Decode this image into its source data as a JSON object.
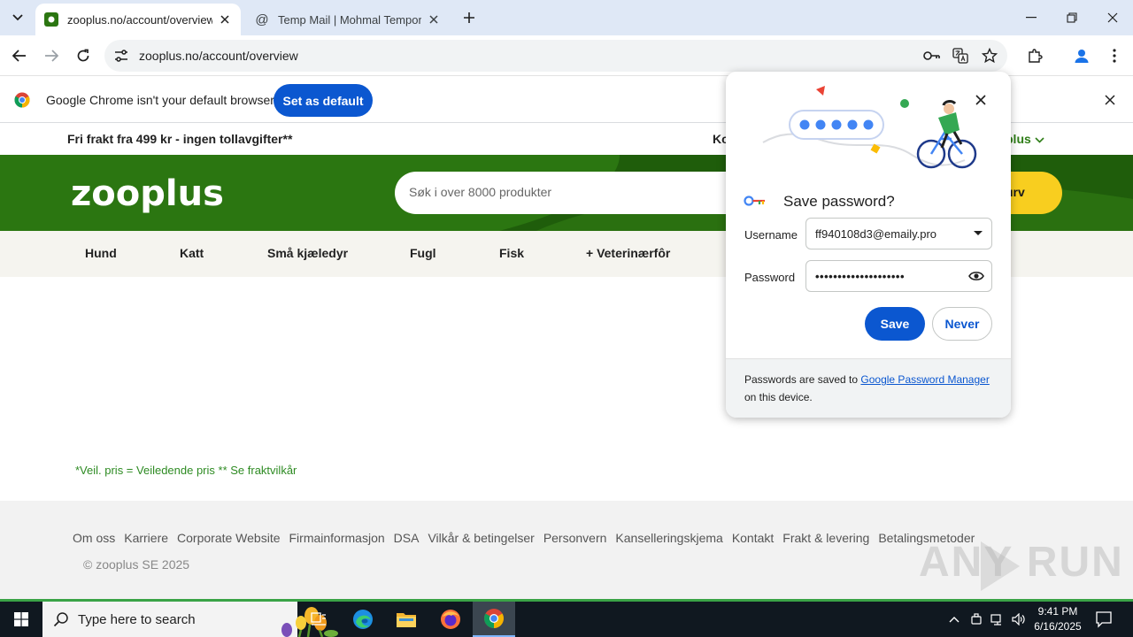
{
  "browser": {
    "tabs": [
      {
        "title": "zooplus.no/account/overview",
        "active": true
      },
      {
        "title": "Temp Mail | Mohmal Temporary",
        "active": false
      }
    ],
    "url": "zooplus.no/account/overview"
  },
  "infobar": {
    "message": "Google Chrome isn't your default browser",
    "button_label": "Set as default"
  },
  "page": {
    "top_banner": "Fri frakt fra 499 kr - ingen tollavgifter**",
    "top_banner_partial": "Ko",
    "top_plus": "plus",
    "logo": "zooplus",
    "search_placeholder": "Søk i over 8000 produkter",
    "cart_partial": "urv",
    "categories": [
      "Hund",
      "Katt",
      "Små kjæledyr",
      "Fugl",
      "Fisk",
      "+ Veterinærfôr"
    ],
    "category_partial": "l",
    "footnote": "*Veil. pris = Veiledende pris ** Se fraktvilkår",
    "footer_links": [
      "Om oss",
      "Karriere",
      "Corporate Website",
      "Firmainformasjon",
      "DSA",
      "Vilkår & betingelser",
      "Personvern",
      "Kanselleringskjema",
      "Kontakt",
      "Frakt & levering",
      "Betalingsmetoder"
    ],
    "copyright": "© zooplus SE 2025",
    "watermark": "ANY RUN"
  },
  "password_dialog": {
    "title": "Save password?",
    "username_label": "Username",
    "username_value": "ff940108d3@emaily.pro",
    "password_label": "Password",
    "password_value": "••••••••••••••••••••",
    "save_label": "Save",
    "never_label": "Never",
    "footer_text": "Passwords are saved to",
    "footer_link": "Google Password Manager",
    "footer_suffix": "on this device."
  },
  "taskbar": {
    "search_placeholder": "Type here to search",
    "time": "9:41 PM",
    "date": "6/16/2025"
  },
  "colors": {
    "accent_blue": "#0b57d0",
    "zooplus_green": "#1f5d0b",
    "cart_yellow": "#f8ce1f"
  }
}
